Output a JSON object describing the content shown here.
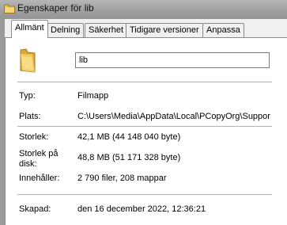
{
  "window": {
    "title": "Egenskaper för lib"
  },
  "tabs": [
    {
      "label": "Allmänt",
      "active": true
    },
    {
      "label": "Delning",
      "active": false
    },
    {
      "label": "Säkerhet",
      "active": false
    },
    {
      "label": "Tidigare versioner",
      "active": false
    },
    {
      "label": "Anpassa",
      "active": false
    }
  ],
  "general": {
    "name_value": "lib",
    "type_label": "Typ:",
    "type_value": "Filmapp",
    "location_label": "Plats:",
    "location_value": "C:\\Users\\Media\\AppData\\Local\\PCopyOrg\\Suppor",
    "size_label": "Storlek:",
    "size_value": "42,1 MB (44 148 040 byte)",
    "size_on_disk_label_line1": "Storlek på",
    "size_on_disk_label_line2": "disk:",
    "size_on_disk_value": "48,8 MB (51 171 328 byte)",
    "contains_label": "Innehåller:",
    "contains_value": "2 790 filer, 208 mappar",
    "created_label": "Skapad:",
    "created_value": "den 16 december 2022, 12:36:21"
  },
  "icons": {
    "title_icon": "folder-icon",
    "main_icon": "folder-icon"
  },
  "colors": {
    "titlebar": "#9e9e9e",
    "folder_yellow": "#e8c35a"
  }
}
